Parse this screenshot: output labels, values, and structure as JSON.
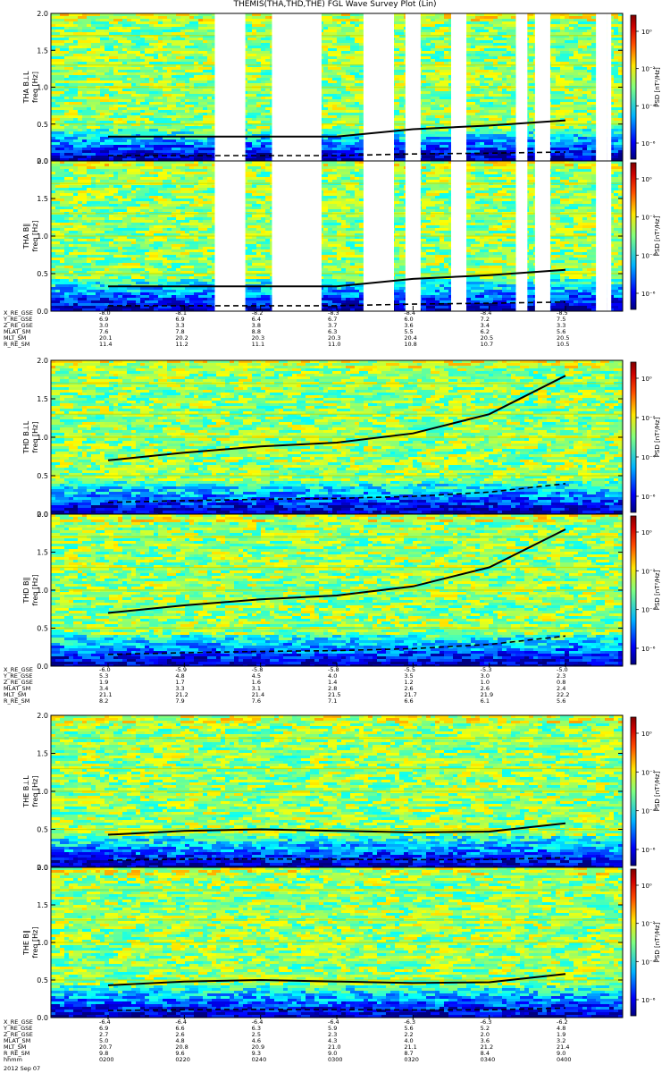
{
  "title": "THEMIS(THA,THD,THE) FGL Wave Survey Plot (Lin)",
  "colorbar_label": "PSD [nT²/Hz]",
  "colorbar_ticks": [
    "10⁰",
    "10⁻²",
    "10⁻⁴",
    "10⁻⁶"
  ],
  "panels": [
    {
      "id": "tha-bll",
      "ylabel1": "THA B⊥L",
      "ylabel2": "freq [Hz]",
      "probe": "tha",
      "comp": "perp"
    },
    {
      "id": "tha-bpar",
      "ylabel1": "THA B∥",
      "ylabel2": "freq [Hz]",
      "probe": "tha",
      "comp": "par"
    },
    {
      "id": "thd-bll",
      "ylabel1": "THD B⊥L",
      "ylabel2": "freq [Hz]",
      "probe": "thd",
      "comp": "perp"
    },
    {
      "id": "thd-bpar",
      "ylabel1": "THD B∥",
      "ylabel2": "freq [Hz]",
      "probe": "thd",
      "comp": "par"
    },
    {
      "id": "the-bll",
      "ylabel1": "THE B⊥L",
      "ylabel2": "freq [Hz]",
      "probe": "the",
      "comp": "perp"
    },
    {
      "id": "the-bpar",
      "ylabel1": "THE B∥",
      "ylabel2": "freq [Hz]",
      "probe": "the",
      "comp": "par"
    }
  ],
  "ephem_labels": [
    "X_RE_GSE",
    "Y_RE_GSE",
    "Z_RE_GSE",
    "MLAT_SM",
    "MLT_SM",
    "R_RE_SM"
  ],
  "ephem": [
    {
      "probe": "tha",
      "rows": [
        [
          "-8.0",
          "-8.1",
          "-8.2",
          "-8.3",
          "-8.4",
          "-8.4",
          "-8.5"
        ],
        [
          "6.9",
          "6.9",
          "6.4",
          "6.7",
          "6.0",
          "7.2",
          "7.5"
        ],
        [
          "3.0",
          "3.3",
          "3.8",
          "3.7",
          "3.6",
          "3.4",
          "3.3"
        ],
        [
          "7.6",
          "7.8",
          "8.8",
          "6.3",
          "5.5",
          "6.2",
          "5.6"
        ],
        [
          "20.1",
          "20.2",
          "20.3",
          "20.3",
          "20.4",
          "20.5",
          "20.5"
        ],
        [
          "11.4",
          "11.2",
          "11.1",
          "11.0",
          "10.8",
          "10.7",
          "10.5"
        ]
      ]
    },
    {
      "probe": "thd",
      "rows": [
        [
          "-6.0",
          "-5.9",
          "-5.8",
          "-5.8",
          "-5.5",
          "-5.3",
          "-5.0"
        ],
        [
          "5.3",
          "4.8",
          "4.5",
          "4.0",
          "3.5",
          "3.0",
          "2.3"
        ],
        [
          "1.9",
          "1.7",
          "1.6",
          "1.4",
          "1.2",
          "1.0",
          "0.8"
        ],
        [
          "3.4",
          "3.3",
          "3.1",
          "2.8",
          "2.6",
          "2.6",
          "2.4"
        ],
        [
          "21.1",
          "21.2",
          "21.4",
          "21.5",
          "21.7",
          "21.9",
          "22.2"
        ],
        [
          "8.2",
          "7.9",
          "7.6",
          "7.1",
          "6.6",
          "6.1",
          "5.6"
        ]
      ]
    },
    {
      "probe": "the",
      "rows": [
        [
          "-6.4",
          "-6.4",
          "-6.4",
          "-6.4",
          "-6.3",
          "-6.3",
          "-6.2"
        ],
        [
          "6.9",
          "6.6",
          "6.3",
          "5.9",
          "5.6",
          "5.2",
          "4.8"
        ],
        [
          "2.7",
          "2.6",
          "2.5",
          "2.3",
          "2.2",
          "2.0",
          "1.9"
        ],
        [
          "5.0",
          "4.8",
          "4.6",
          "4.3",
          "4.0",
          "3.6",
          "3.2"
        ],
        [
          "20.7",
          "20.8",
          "20.9",
          "21.0",
          "21.1",
          "21.2",
          "21.4"
        ],
        [
          "9.8",
          "9.6",
          "9.3",
          "9.0",
          "8.7",
          "8.4",
          "9.0"
        ]
      ]
    }
  ],
  "time_axis": {
    "label": "hhmm",
    "ticks": [
      "0200",
      "0220",
      "0240",
      "0300",
      "0320",
      "0340",
      "0400"
    ]
  },
  "date": "2012 Sep 07",
  "chart_data": {
    "type": "heatmap",
    "title": "THEMIS(THA,THD,THE) FGL Wave Survey Plot (Lin)",
    "xlabel": "hhmm",
    "x_ticks": [
      "0200",
      "0220",
      "0240",
      "0300",
      "0320",
      "0340",
      "0400"
    ],
    "ylabel": "freq [Hz]",
    "ylim": [
      0,
      2.0
    ],
    "y_ticks": [
      0.0,
      0.5,
      1.0,
      1.5,
      2.0
    ],
    "colorbar": {
      "label": "PSD [nT²/Hz]",
      "scale": "log",
      "ticks": [
        "10⁰",
        "10⁻²",
        "10⁻⁴",
        "10⁻⁶"
      ]
    },
    "gaps_tha_hhmm": [
      [
        "0228",
        "0236"
      ],
      [
        "0243",
        "0256"
      ],
      [
        "0307",
        "0315"
      ],
      [
        "0318",
        "0322"
      ],
      [
        "0330",
        "0334"
      ],
      [
        "0347",
        "0350"
      ],
      [
        "0352",
        "0356"
      ],
      [
        "0408",
        "0411"
      ],
      [
        "0411",
        "0412"
      ]
    ],
    "overlay_lines": {
      "tha": {
        "x": [
          "0200",
          "0220",
          "0240",
          "0300",
          "0320",
          "0340",
          "0400"
        ],
        "f_ci": [
          0.33,
          0.33,
          0.33,
          0.33,
          0.43,
          0.48,
          0.55
        ]
      },
      "thd": {
        "x": [
          "0200",
          "0220",
          "0240",
          "0300",
          "0320",
          "0340",
          "0400"
        ],
        "f_ci": [
          0.7,
          0.8,
          0.88,
          0.93,
          1.05,
          1.3,
          1.8
        ]
      },
      "the": {
        "x": [
          "0200",
          "0220",
          "0240",
          "0300",
          "0320",
          "0340",
          "0400"
        ],
        "f_ci": [
          0.43,
          0.48,
          0.5,
          0.48,
          0.46,
          0.47,
          0.58
        ]
      }
    }
  }
}
